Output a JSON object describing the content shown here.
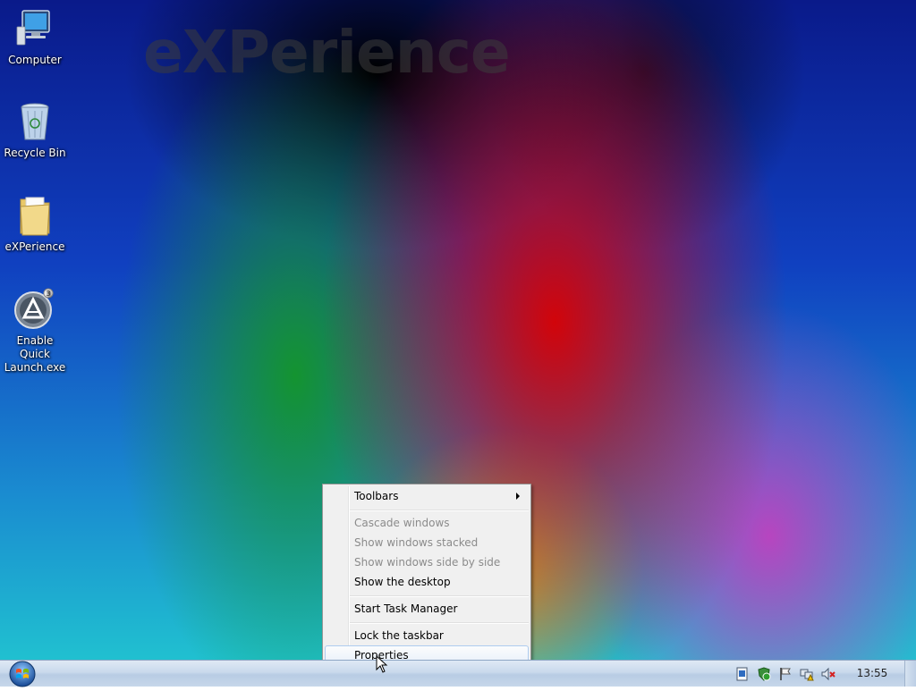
{
  "wallpaper": {
    "watermark": "eXPerience"
  },
  "desktop_icons": [
    {
      "name": "computer",
      "label": "Computer"
    },
    {
      "name": "recycle-bin",
      "label": "Recycle Bin"
    },
    {
      "name": "folder",
      "label": "eXPerience"
    },
    {
      "name": "quick-launch",
      "label": "Enable Quick Launch.exe"
    }
  ],
  "context_menu": {
    "items": [
      {
        "label": "Toolbars",
        "enabled": true,
        "submenu": true
      },
      {
        "label": "Cascade windows",
        "enabled": false
      },
      {
        "label": "Show windows stacked",
        "enabled": false
      },
      {
        "label": "Show windows side by side",
        "enabled": false
      },
      {
        "label": "Show the desktop",
        "enabled": true
      },
      {
        "label": "Start Task Manager",
        "enabled": true
      },
      {
        "label": "Lock the taskbar",
        "enabled": true
      },
      {
        "label": "Properties",
        "enabled": true,
        "highlighted": true
      }
    ]
  },
  "taskbar": {
    "start_icon": "windows-orb-icon",
    "tray_icons": [
      "action-center-icon",
      "security-icon",
      "flag-icon",
      "network-warning-icon",
      "volume-muted-icon"
    ],
    "clock": "13:55"
  },
  "colors": {
    "menu_bg": "#f0f0f0",
    "menu_highlight_border": "#aeccf0",
    "taskbar": "#c9d9ec"
  }
}
